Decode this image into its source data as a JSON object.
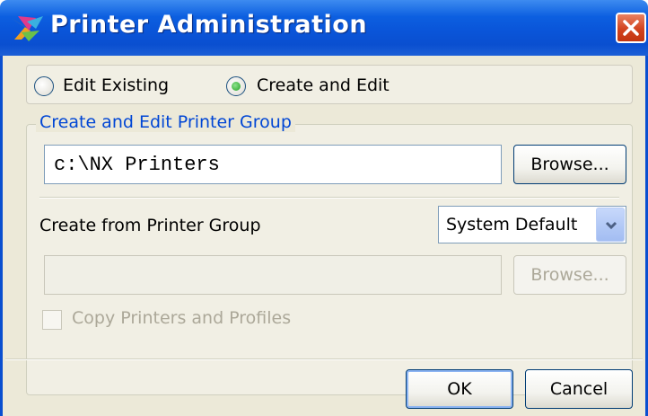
{
  "window": {
    "title": "Printer Administration",
    "logo_icon": "nx-logo-icon",
    "close_icon": "close-icon"
  },
  "mode": {
    "options": [
      {
        "label": "Edit Existing",
        "selected": false
      },
      {
        "label": "Create and Edit",
        "selected": true
      }
    ]
  },
  "group": {
    "legend": "Create and Edit Printer Group",
    "path_value": "c:\\NX Printers",
    "browse_label": "Browse...",
    "create_from_label": "Create from Printer Group",
    "create_from_select": "System Default",
    "source_path_value": "",
    "source_browse_label": "Browse...",
    "copy_checkbox_label": "Copy Printers and Profiles",
    "copy_checked": false
  },
  "footer": {
    "ok_label": "OK",
    "cancel_label": "Cancel"
  },
  "colors": {
    "titlebar": "#0a55d9",
    "legend_text": "#0046d5",
    "window_bg": "#ece9d8"
  }
}
